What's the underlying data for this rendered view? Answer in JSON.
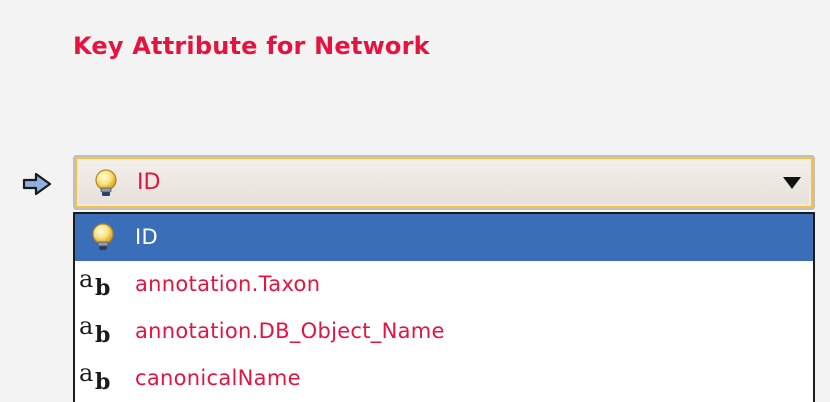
{
  "section": {
    "title": "Key Attribute for Network"
  },
  "combo": {
    "selected_label": "ID",
    "selected_icon": "lightbulb-icon"
  },
  "dropdown": {
    "options": [
      {
        "label": "ID",
        "icon": "lightbulb-icon",
        "selected": true
      },
      {
        "label": "annotation.Taxon",
        "icon": "string-type-icon",
        "selected": false
      },
      {
        "label": "annotation.DB_Object_Name",
        "icon": "string-type-icon",
        "selected": false
      },
      {
        "label": "canonicalName",
        "icon": "string-type-icon",
        "selected": false
      }
    ]
  },
  "colors": {
    "accent_text": "#e3143f",
    "selection_bg": "#3b6eb8",
    "combo_focus_border": "#f4c04a"
  }
}
